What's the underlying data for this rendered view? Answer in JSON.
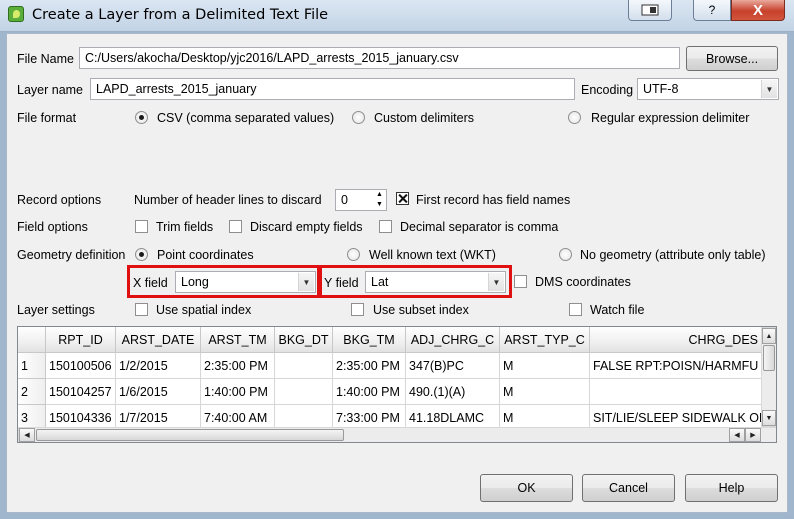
{
  "window": {
    "title": "Create a Layer from a Delimited Text File"
  },
  "file_name": {
    "label": "File Name",
    "value": "C:/Users/akocha/Desktop/yjc2016/LAPD_arrests_2015_january.csv",
    "browse_label": "Browse..."
  },
  "layer_name": {
    "label": "Layer name",
    "value": "LAPD_arrests_2015_january"
  },
  "encoding": {
    "label": "Encoding",
    "value": "UTF-8"
  },
  "file_format": {
    "label": "File format",
    "options": [
      "CSV (comma separated values)",
      "Custom delimiters",
      "Regular expression delimiter"
    ],
    "selected": "CSV (comma separated values)"
  },
  "record_options": {
    "label": "Record options",
    "header_lines_label": "Number of header lines to discard",
    "header_lines_value": "0",
    "first_record_label": "First record has field names",
    "first_record_checked": true
  },
  "field_options": {
    "label": "Field options",
    "trim_label": "Trim fields",
    "discard_empty_label": "Discard empty fields",
    "decimal_comma_label": "Decimal separator is comma"
  },
  "geometry": {
    "label": "Geometry definition",
    "options": [
      "Point coordinates",
      "Well known text (WKT)",
      "No geometry (attribute only table)"
    ],
    "selected": "Point coordinates",
    "x_label": "X field",
    "x_value": "Long",
    "y_label": "Y field",
    "y_value": "Lat",
    "dms_label": "DMS coordinates"
  },
  "layer_settings": {
    "label": "Layer settings",
    "spatial_index_label": "Use spatial index",
    "subset_index_label": "Use subset index",
    "watch_file_label": "Watch file"
  },
  "table": {
    "columns": [
      "RPT_ID",
      "ARST_DATE",
      "ARST_TM",
      "BKG_DT",
      "BKG_TM",
      "ADJ_CHRG_C",
      "ARST_TYP_C",
      "CHRG_DES"
    ],
    "rows": [
      {
        "n": "1",
        "cells": [
          "150100506",
          "1/2/2015",
          "2:35:00 PM",
          "",
          "2:35:00 PM",
          "347(B)PC",
          "M",
          "FALSE RPT:POISN/HARMFU S"
        ]
      },
      {
        "n": "2",
        "cells": [
          "150104257",
          "1/6/2015",
          "1:40:00 PM",
          "",
          "1:40:00 PM",
          "490.(1)(A)",
          "M",
          ""
        ]
      },
      {
        "n": "3",
        "cells": [
          "150104336",
          "1/7/2015",
          "7:40:00 AM",
          "",
          "7:33:00 PM",
          "41.18DLAMC",
          "M",
          "SIT/LIE/SLEEP SIDEWALK OR"
        ]
      }
    ]
  },
  "buttons": {
    "ok": "OK",
    "cancel": "Cancel",
    "help": "Help"
  },
  "titlebar_buttons": {
    "help": "?",
    "close": "X"
  }
}
